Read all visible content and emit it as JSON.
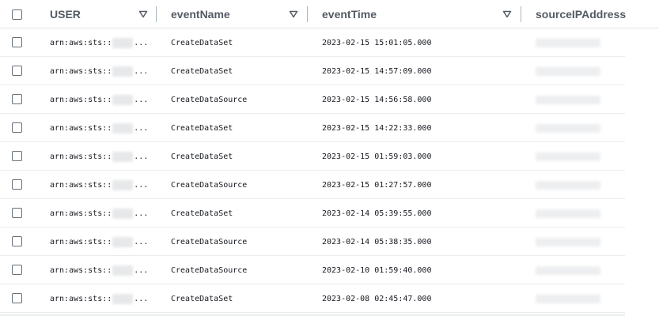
{
  "table": {
    "columns": [
      {
        "label": "USER",
        "sortable": true
      },
      {
        "label": "eventName",
        "sortable": true
      },
      {
        "label": "eventTime",
        "sortable": true
      },
      {
        "label": "sourceIPAddress",
        "sortable": false
      }
    ],
    "rows": [
      {
        "user_prefix": "arn:aws:sts::",
        "user_suffix": "...",
        "eventName": "CreateDataSet",
        "eventTime": "2023-02-15 15:01:05.000"
      },
      {
        "user_prefix": "arn:aws:sts::",
        "user_suffix": "...",
        "eventName": "CreateDataSet",
        "eventTime": "2023-02-15 14:57:09.000"
      },
      {
        "user_prefix": "arn:aws:sts::",
        "user_suffix": "...",
        "eventName": "CreateDataSource",
        "eventTime": "2023-02-15 14:56:58.000"
      },
      {
        "user_prefix": "arn:aws:sts::",
        "user_suffix": "...",
        "eventName": "CreateDataSet",
        "eventTime": "2023-02-15 14:22:33.000"
      },
      {
        "user_prefix": "arn:aws:sts::",
        "user_suffix": "...",
        "eventName": "CreateDataSet",
        "eventTime": "2023-02-15 01:59:03.000"
      },
      {
        "user_prefix": "arn:aws:sts::",
        "user_suffix": "...",
        "eventName": "CreateDataSource",
        "eventTime": "2023-02-15 01:27:57.000"
      },
      {
        "user_prefix": "arn:aws:sts::",
        "user_suffix": "...",
        "eventName": "CreateDataSet",
        "eventTime": "2023-02-14 05:39:55.000"
      },
      {
        "user_prefix": "arn:aws:sts::",
        "user_suffix": "...",
        "eventName": "CreateDataSource",
        "eventTime": "2023-02-14 05:38:35.000"
      },
      {
        "user_prefix": "arn:aws:sts::",
        "user_suffix": "...",
        "eventName": "CreateDataSource",
        "eventTime": "2023-02-10 01:59:40.000"
      },
      {
        "user_prefix": "arn:aws:sts::",
        "user_suffix": "...",
        "eventName": "CreateDataSet",
        "eventTime": "2023-02-08 02:45:47.000"
      }
    ]
  },
  "icons": {
    "sort": "caret-down-icon",
    "checkbox": "checkbox-icon"
  },
  "colors": {
    "header_text": "#545b64",
    "body_text": "#16191f",
    "divider": "#aab7b8",
    "row_separator": "#eaeded"
  }
}
